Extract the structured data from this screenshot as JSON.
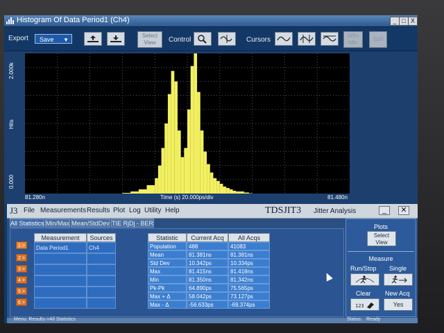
{
  "colors": {
    "histogram": "#f2f060",
    "plot_bg": "#000000",
    "grid": "#555555",
    "accent": "#d9742a"
  },
  "histogram_window": {
    "title": "Histogram Of Data Period1 (Ch4)",
    "buttons": {
      "minimize": "_",
      "maximize": "□",
      "close": "X"
    },
    "toolbar": {
      "export_label": "Export",
      "save_label": "Save",
      "select_view_label": "Select View",
      "control_label": "Control",
      "cursors_label": "Cursors",
      "zoom_label": "Wfm Mkr",
      "split_label": "Split"
    },
    "plot": {
      "y_axis_label": "Hits",
      "y_top_tick": "2.000k",
      "y_bottom_tick": "0.000",
      "x_left_tick": "81.280n",
      "x_right_tick": "81.480n",
      "x_axis_label": "Time (s)  20.000ps/div"
    }
  },
  "chart_data": {
    "type": "bar",
    "title": "Histogram Of Data Period1 (Ch4)",
    "xlabel": "Time (s)",
    "ylabel": "Hits",
    "x_range": [
      81.28,
      81.48
    ],
    "ylim": [
      0,
      2000
    ],
    "x": [
      81.34,
      81.345,
      81.35,
      81.355,
      81.36,
      81.362,
      81.364,
      81.366,
      81.368,
      81.37,
      81.372,
      81.374,
      81.376,
      81.378,
      81.38,
      81.382,
      81.384,
      81.386,
      81.388,
      81.39,
      81.392,
      81.394,
      81.396,
      81.398,
      81.4,
      81.402,
      81.404,
      81.406,
      81.408,
      81.41,
      81.415,
      81.418
    ],
    "values": [
      10,
      30,
      60,
      120,
      220,
      400,
      650,
      1000,
      1420,
      1750,
      1600,
      900,
      520,
      650,
      1200,
      1820,
      2000,
      1450,
      900,
      600,
      420,
      300,
      220,
      180,
      140,
      100,
      80,
      60,
      40,
      30,
      15,
      5
    ],
    "grid": true
  },
  "jit3": {
    "logo": "J3",
    "menu": [
      "File",
      "Measurements",
      "Results",
      "Plot",
      "Log",
      "Utility",
      "Help"
    ],
    "title": "TDSJIT3",
    "subtitle": "Jitter Analysis",
    "tabs": [
      "All Statistics",
      "Min/Max",
      "Mean/StdDev",
      "TIE RjDj - BER"
    ],
    "row_numbers": [
      "1 >",
      "2 >",
      "3 >",
      "4 >",
      "5 >",
      "6 >"
    ],
    "measurement_table": {
      "headers": [
        "Measurement",
        "Sources"
      ],
      "rows": [
        [
          "Data Period1",
          "Ch4"
        ],
        [
          "",
          ""
        ],
        [
          "",
          ""
        ],
        [
          "",
          ""
        ],
        [
          "",
          ""
        ],
        [
          "",
          ""
        ]
      ]
    },
    "stats_table": {
      "headers": [
        "Statistic",
        "Current Acq",
        "All Acqs"
      ],
      "rows": [
        [
          "Population",
          "488",
          "41083"
        ],
        [
          "Mean",
          "81.381ns",
          "81.381ns"
        ],
        [
          "Std Dev",
          "10.342ps",
          "10.334ps"
        ],
        [
          "Max",
          "81.415ns",
          "81.418ns"
        ],
        [
          "Min",
          "81.350ns",
          "81.342ns"
        ],
        [
          "Pk-Pk",
          "64.890ps",
          "75.565ps"
        ],
        [
          "Max + Δ",
          "58.042ps",
          "73.127ps"
        ],
        [
          "Max - Δ",
          "-56.633ps",
          "-69.374ps"
        ]
      ]
    },
    "right_panel": {
      "plots_label": "Plots",
      "select_view_label": "Select View",
      "measure_label": "Measure",
      "run_stop_label": "Run/Stop",
      "single_label": "Single",
      "clear_label": "Clear",
      "new_acq_label": "New Acq",
      "yes_label": "Yes"
    },
    "status": {
      "left": "Menu: Results->All Statistics",
      "right_label": "Status:",
      "right_value": "Ready"
    }
  }
}
